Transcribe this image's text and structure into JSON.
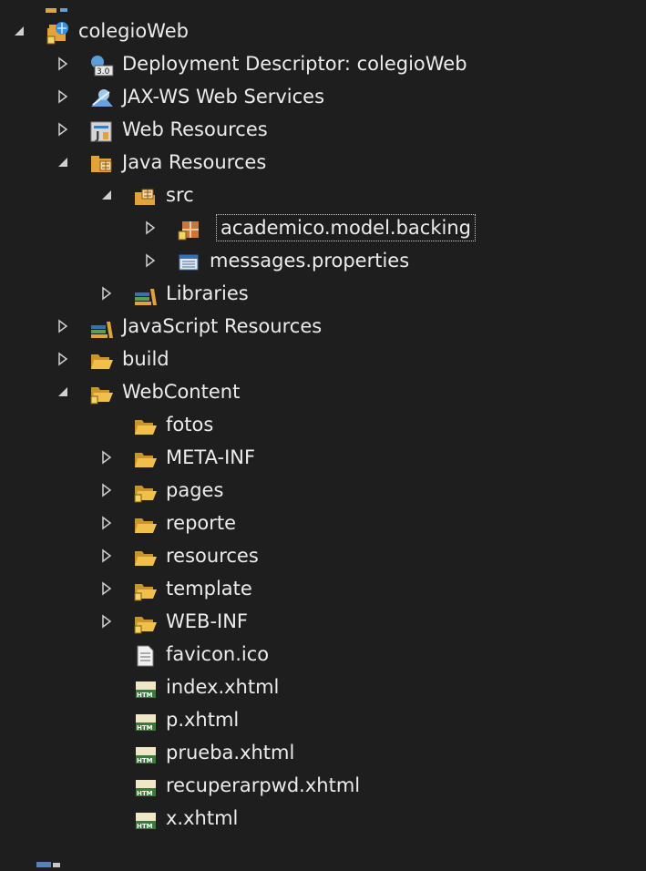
{
  "tree": {
    "root_label": "colegioWeb",
    "deployment_descriptor_label": "Deployment Descriptor: colegioWeb",
    "jaxws_label": "JAX-WS Web Services",
    "web_resources_label": "Web Resources",
    "java_resources_label": "Java Resources",
    "src_label": "src",
    "package_label": "academico.model.backing",
    "messages_label": "messages.properties",
    "libraries_label": "Libraries",
    "javascript_resources_label": "JavaScript Resources",
    "build_label": "build",
    "webcontent_label": "WebContent",
    "folders": [
      "fotos",
      "META-INF",
      "pages",
      "reporte",
      "resources",
      "template",
      "WEB-INF"
    ],
    "files": [
      "favicon.ico",
      "index.xhtml",
      "p.xhtml",
      "prueba.xhtml",
      "recuperarpwd.xhtml",
      "x.xhtml"
    ],
    "icon_badge_text": "3.0",
    "htm_badge_text": "HTM"
  },
  "colors": {
    "background": "#1e1e1e",
    "text": "#ececec",
    "folder": "#e8b33a",
    "arrow": "#d0d0d0"
  }
}
